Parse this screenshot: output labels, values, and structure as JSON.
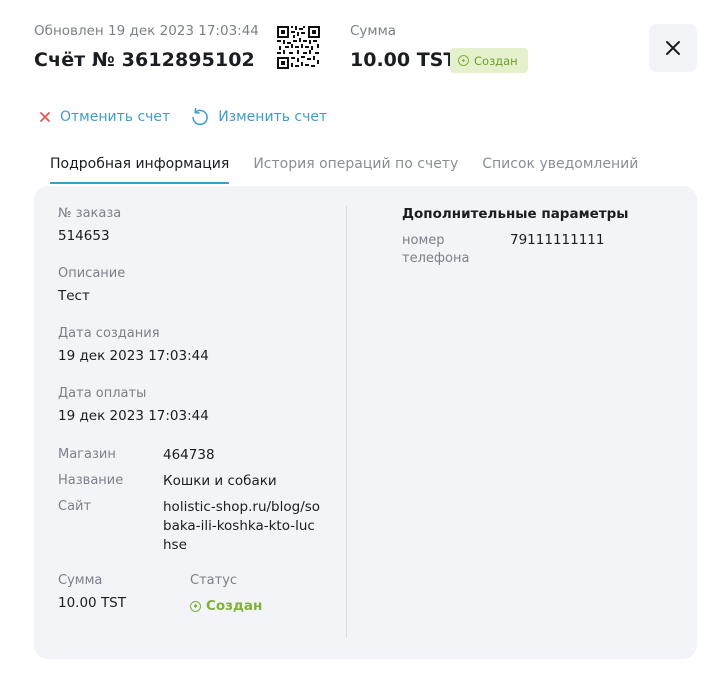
{
  "header": {
    "updated": "Обновлен 19 дек 2023 17:03:44",
    "invoice_title": "Счёт № 3612895102",
    "sum_label": "Сумма",
    "sum_value": "10.00 TST",
    "status_badge": "Создан",
    "qr_icon": "qr-code-icon",
    "close_icon": "close-icon"
  },
  "actions": {
    "cancel_label": "Отменить счет",
    "edit_label": "Изменить счет"
  },
  "tabs": [
    {
      "label": "Подробная информация",
      "active": true
    },
    {
      "label": "История операций по счету",
      "active": false
    },
    {
      "label": "Список уведомлений",
      "active": false
    }
  ],
  "details": {
    "order_label": "№ заказа",
    "order_value": "514653",
    "description_label": "Описание",
    "description_value": "Тест",
    "created_label": "Дата создания",
    "created_value": "19 дек 2023 17:03:44",
    "paid_label": "Дата оплаты",
    "paid_value": "19 дек 2023 17:03:44",
    "shop_label": "Магазин",
    "shop_value": "464738",
    "name_label": "Название",
    "name_value": "Кошки и собаки",
    "site_label": "Сайт",
    "site_value": "holistic-shop.ru/blog/sobaka-ili-koshka-kto-luchse",
    "amount_label": "Сумма",
    "amount_value": "10.00 TST",
    "status_label": "Статус",
    "status_value": "Создан"
  },
  "params": {
    "title": "Дополнительные параметры",
    "phone_label": "номер телефона",
    "phone_value": "79111111111"
  },
  "colors": {
    "accent": "#3f9ec8",
    "cancel": "#e25555",
    "success": "#7fb23a",
    "badge_bg": "#e4f1cc",
    "panel_bg": "#f2f4f7"
  }
}
